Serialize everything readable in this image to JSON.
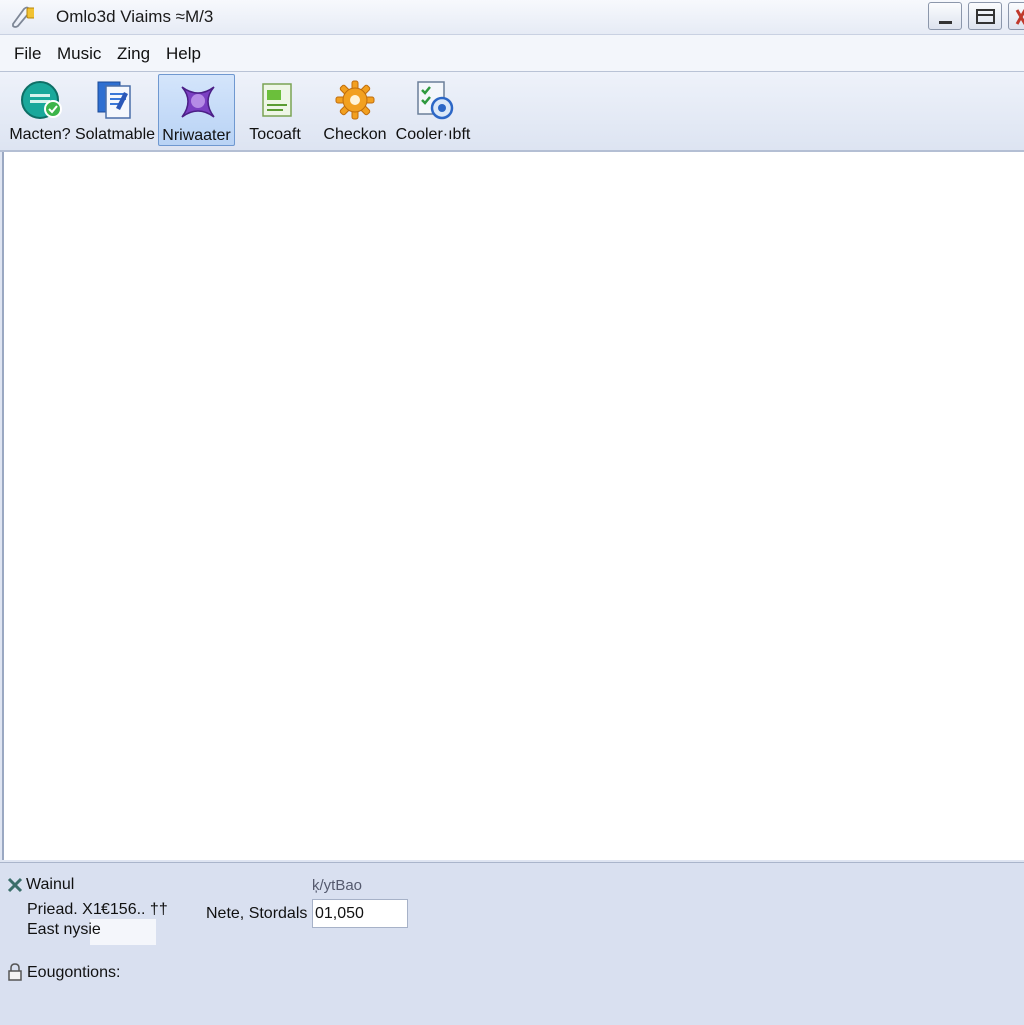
{
  "window": {
    "title": "Omlo3d Viaims ≈M/3",
    "controls": [
      "minimize",
      "maximize",
      "close"
    ]
  },
  "menu": [
    "File",
    "Music",
    "Zing",
    "Help"
  ],
  "toolbar": {
    "items": [
      {
        "label": "Macten?",
        "icon": "globe-icon",
        "active": false
      },
      {
        "label": "Solatmable",
        "icon": "documents-icon",
        "active": false
      },
      {
        "label": "Nriwaater",
        "icon": "purple-gem-icon",
        "active": true
      },
      {
        "label": "Tocoaft",
        "icon": "green-document-icon",
        "active": false
      },
      {
        "label": "Checkon",
        "icon": "gear-icon",
        "active": false
      },
      {
        "label": "Cooler·ıbft",
        "icon": "checklist-icon",
        "active": false
      }
    ]
  },
  "panel": {
    "title": "Wainul",
    "column_header": "ķ/ytBao",
    "priead_label": "Priead. X1",
    "priead_value": "€156.. ††",
    "east_label": "East nysie",
    "nete_label": "Nete, Stordals",
    "nete_value": "01,050",
    "footer_label": "Eougontions:"
  },
  "colors": {
    "active_tool_bg": "#c7dcf7",
    "panel_bg": "#d9e0f0",
    "content_bg": "#ffffff"
  }
}
